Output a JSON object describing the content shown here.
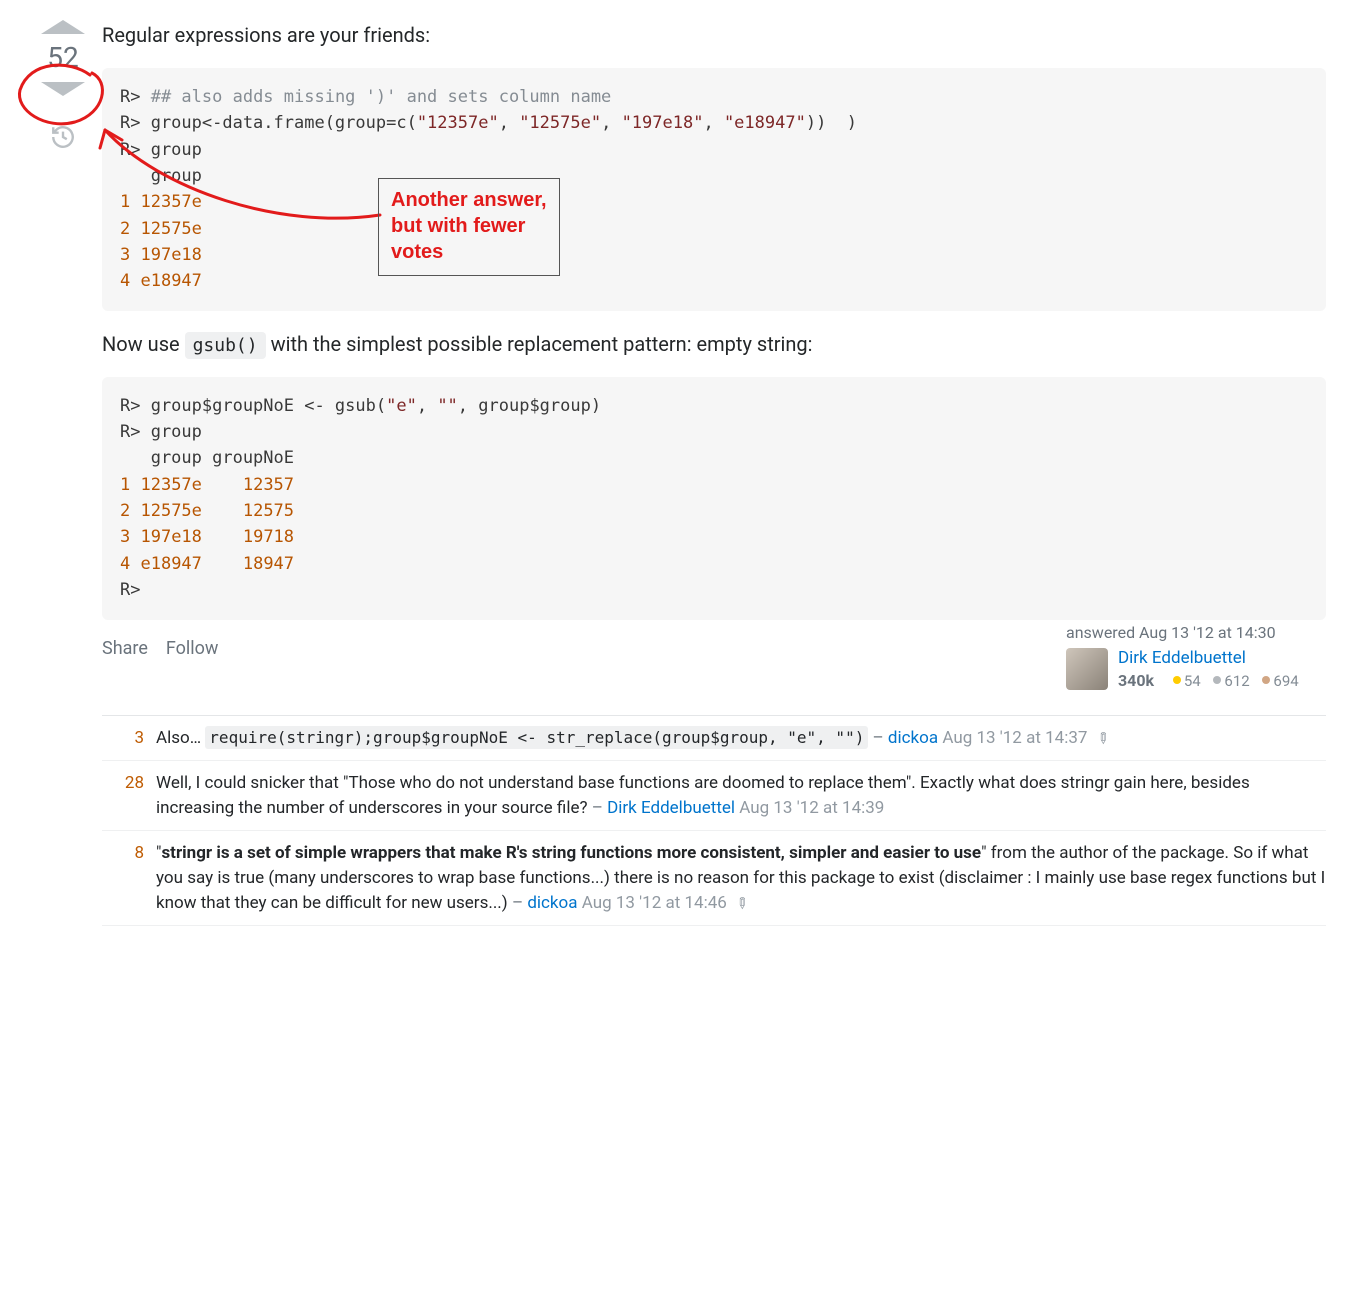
{
  "vote": {
    "score": "52"
  },
  "post": {
    "intro": "Regular expressions are your friends:",
    "mid": "Now use ",
    "mid_code": "gsub()",
    "mid_tail": " with the simplest possible replacement pattern: empty string:"
  },
  "code1": {
    "p1": "R> ",
    "comment": "## also adds missing ')' and sets column name",
    "l2a": "R> group<-data.frame(group=c(",
    "s1": "\"12357e\"",
    "s2": "\"12575e\"",
    "s3": "\"197e18\"",
    "s4": "\"e18947\"",
    "l2b": "))  )",
    "l3": "R> group",
    "l4": "   group",
    "n1": "1",
    "v1": " 12357e",
    "n2": "2",
    "v2": " 12575e",
    "n3": "3",
    "v3": " 197e18",
    "n4": "4",
    "v4": " e18947"
  },
  "code2": {
    "l1a": "R> group$groupNoE <- gsub(",
    "s1": "\"e\"",
    "s2": "\"\"",
    "l1b": ", group$group)",
    "l2": "R> group",
    "l3": "   group groupNoE",
    "n1": "1",
    "a1": " 12357e",
    "b1": "    12357",
    "n2": "2",
    "a2": " 12575e",
    "b2": "    12575",
    "n3": "3",
    "a3": " 197e18",
    "b3": "    19718",
    "n4": "4",
    "a4": " e18947",
    "b4": "    18947",
    "l8": "R> "
  },
  "actions": {
    "share": "Share",
    "follow": "Follow"
  },
  "user": {
    "answered": "answered Aug 13 '12 at 14:30",
    "name": "Dirk Eddelbuettel",
    "rep": "340k",
    "gold": "54",
    "silver": "612",
    "bronze": "694"
  },
  "comments": [
    {
      "score": "3",
      "pre": "Also… ",
      "code": "require(stringr);group$groupNoE <- str_replace(group$group, \"e\", \"\")",
      "post": "",
      "author": "dickoa",
      "time": "Aug 13 '12 at 14:37",
      "edited": true
    },
    {
      "score": "28",
      "pre": "Well, I could snicker that \"Those who do not understand base functions are doomed to replace them\". Exactly what does stringr gain here, besides increasing the number of underscores in your source file?",
      "code": "",
      "post": "",
      "author": "Dirk Eddelbuettel",
      "time": "Aug 13 '12 at 14:39",
      "edited": false
    },
    {
      "score": "8",
      "bold": "stringr is a set of simple wrappers that make R's string functions more consistent, simpler and easier to use",
      "pre": "\"",
      "post": "\" from the author of the package. So if what you say is true (many underscores to wrap base functions...) there is no reason for this package to exist (disclaimer : I mainly use base regex functions but I know that they can be difficult for new users...)",
      "code": "",
      "author": "dickoa",
      "time": "Aug 13 '12 at 14:46",
      "edited": true
    }
  ],
  "annotation": {
    "line1": "Another answer,",
    "line2": "but with fewer",
    "line3": "votes"
  }
}
